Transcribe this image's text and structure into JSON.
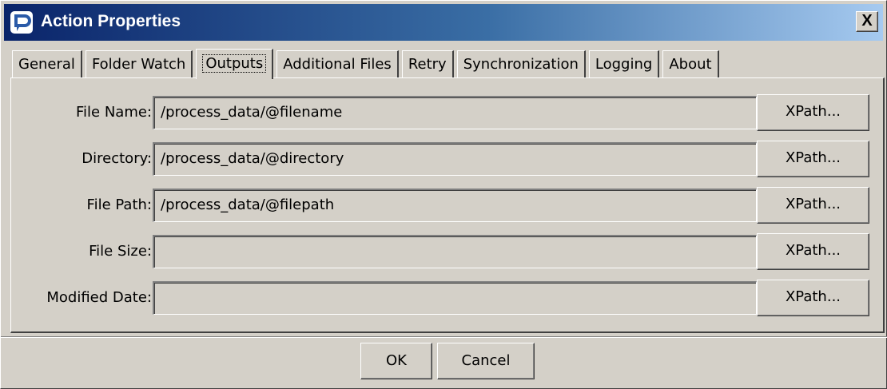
{
  "window": {
    "title": "Action Properties",
    "close_label": "X"
  },
  "tabs": [
    {
      "label": "General",
      "active": false
    },
    {
      "label": "Folder Watch",
      "active": false
    },
    {
      "label": "Outputs",
      "active": true
    },
    {
      "label": "Additional Files",
      "active": false
    },
    {
      "label": "Retry",
      "active": false
    },
    {
      "label": "Synchronization",
      "active": false
    },
    {
      "label": "Logging",
      "active": false
    },
    {
      "label": "About",
      "active": false
    }
  ],
  "fields": [
    {
      "label": "File Name:",
      "value": "/process_data/@filename",
      "button": "XPath..."
    },
    {
      "label": "Directory:",
      "value": "/process_data/@directory",
      "button": "XPath..."
    },
    {
      "label": "File Path:",
      "value": "/process_data/@filepath",
      "button": "XPath..."
    },
    {
      "label": "File Size:",
      "value": "",
      "button": "XPath..."
    },
    {
      "label": "Modified Date:",
      "value": "",
      "button": "XPath..."
    }
  ],
  "footer": {
    "ok_label": "OK",
    "cancel_label": "Cancel"
  },
  "colors": {
    "window_bg": "#d4d0c8",
    "titlebar_start": "#0a246a",
    "titlebar_end": "#a6caf0",
    "title_text": "#ffffff"
  }
}
